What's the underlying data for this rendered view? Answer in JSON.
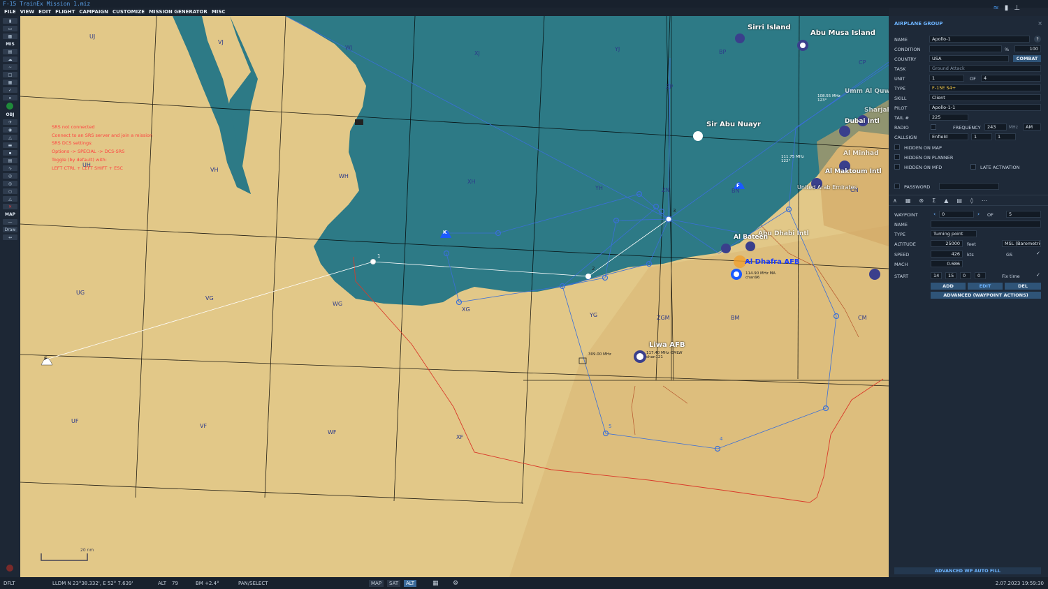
{
  "window": {
    "title": "F-15 TrainEx Mission 1.miz"
  },
  "menu": [
    "FILE",
    "VIEW",
    "EDIT",
    "FLIGHT",
    "CAMPAIGN",
    "CUSTOMIZE",
    "MISSION GENERATOR",
    "MISC"
  ],
  "toolbar": {
    "mis_label": "MIS",
    "obj_label": "OBJ",
    "map_label": "MAP",
    "draw_label": "Draw"
  },
  "srs_message": [
    "SRS not connected",
    "Connect to an SRS server and join a mission",
    "SRS DCS settings:",
    "Options -> SPECIAL -> DCS-SRS",
    "Toggle (by default) with:",
    "LEFT CTRL + LEFT SHIFT + ESC"
  ],
  "map": {
    "grid_labels": [
      "UJ",
      "VJ",
      "WJ",
      "XJ",
      "YJ",
      "BP",
      "CP",
      "VH",
      "WH",
      "XH",
      "YH",
      "ZN",
      "BN",
      "CN",
      "UH",
      "UG",
      "VG",
      "WG",
      "XG",
      "YG",
      "ZGM",
      "BM",
      "CM",
      "UF",
      "VF",
      "WF",
      "XF",
      "ZP"
    ],
    "places": [
      "Sirri Island",
      "Abu Musa Island",
      "Sir Abu Nuayr",
      "Umm Al Quwain",
      "Sharjah",
      "Dubai Intl",
      "Al Minhad",
      "Al Maktoum Intl",
      "United Arab Emirates",
      "Al Dhafra AFB",
      "Liwa AFB",
      "Abu Dhabi Intl",
      "Al Bateen"
    ],
    "freq_labels": [
      "309.00 MHz",
      "108.55 MHz 123°",
      "111.75 MHz 122°",
      "114.90 MHz MA chan96",
      "117.40 MHz OMLW chan121"
    ],
    "group_labels": [
      "K",
      "F",
      "F"
    ],
    "waypoint_numbers": [
      "1",
      "2",
      "3",
      "4",
      "5"
    ],
    "scale": "20 nm"
  },
  "panel": {
    "header": "AIRPLANE GROUP",
    "name_label": "NAME",
    "name_value": "Apollo-1",
    "help_icon": "?",
    "condition_label": "CONDITION",
    "condition_pct": "%",
    "condition_value": "100",
    "country_label": "COUNTRY",
    "country_value": "USA",
    "combat_btn": "COMBAT",
    "task_label": "TASK",
    "task_value": "Ground Attack",
    "unit_label": "UNIT",
    "unit_value": "1",
    "unit_of": "OF",
    "unit_total": "4",
    "type_label": "TYPE",
    "type_value": "F-15E S4+",
    "skill_label": "SKILL",
    "skill_value": "Client",
    "pilot_label": "PILOT",
    "pilot_value": "Apollo-1-1",
    "tail_label": "TAIL #",
    "tail_value": "225",
    "radio_label": "RADIO",
    "frequency_label": "FREQUENCY",
    "frequency_value": "243",
    "freq_unit": "MHz",
    "modulation": "AM",
    "callsign_label": "CALLSIGN",
    "callsign_value": "Enfield",
    "callsign_n1": "1",
    "callsign_n2": "1",
    "hidden_map": "HIDDEN ON MAP",
    "hidden_planner": "HIDDEN ON PLANNER",
    "hidden_mfd": "HIDDEN ON MFD",
    "late_activation": "LATE ACTIVATION",
    "password_label": "PASSWORD",
    "waypoint_label": "WAYPOINT",
    "waypoint_value": "0",
    "waypoint_of": "OF",
    "waypoint_total": "5",
    "wp_name_label": "NAME",
    "wp_type_label": "TYPE",
    "wp_type_value": "Turning point",
    "altitude_label": "ALTITUDE",
    "altitude_value": "25000",
    "altitude_unit": "feet",
    "altitude_mode": "MSL (Barometric)",
    "speed_label": "SPEED",
    "speed_value": "426",
    "speed_unit": "kts",
    "speed_mode": "GS",
    "mach_label": "MACH",
    "mach_value": "0.686",
    "start_label": "START",
    "start_h": "14",
    "start_m": "15",
    "start_s": "0",
    "start_ms": "0",
    "fix_time": "Fix time",
    "add_btn": "ADD",
    "edit_btn": "EDIT",
    "del_btn": "DEL",
    "advanced_btn": "ADVANCED (WAYPOINT ACTIONS)",
    "autofill_btn": "ADVANCED WP AUTO FILL"
  },
  "status": {
    "profile": "DFLT",
    "coords": "LLDM  N 23°38.332', E 52° 7.639'",
    "alt_label": "ALT",
    "alt_value": "79",
    "bm": "BM  +2.4°",
    "mode": "PAN/SELECT",
    "map_btn": "MAP",
    "sat_btn": "SAT",
    "alt_btn": "ALT",
    "datetime": "2.07.2023 19:59:30"
  },
  "colors": {
    "sea": "#2d7a86",
    "land": "#e2c888",
    "route": "#3a6fd8",
    "border": "#d93a2a",
    "accent": "#4ca3ff"
  }
}
